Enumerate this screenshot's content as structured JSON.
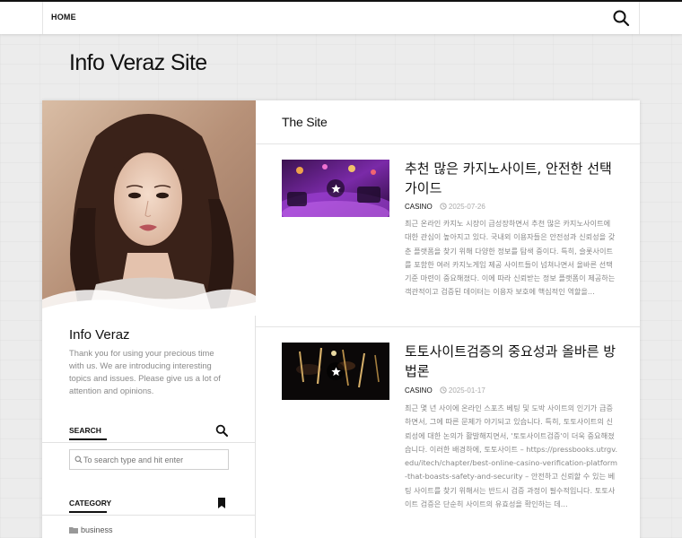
{
  "nav": {
    "home_label": "HOME"
  },
  "site": {
    "title": "Info Veraz Site"
  },
  "sidebar": {
    "profile_name": "Info Veraz",
    "profile_bio": "Thank you for using your precious time with us. We are introducing interesting topics and issues. Please give us a lot of attention and opinions.",
    "search_heading": "SEARCH",
    "search_placeholder": "To search type and hit enter",
    "category_heading": "CATEGORY",
    "categories": [
      {
        "label": "business"
      }
    ]
  },
  "main": {
    "section_title": "The Site",
    "posts": [
      {
        "title": "추천 많은 카지노사이트, 안전한 선택 가이드",
        "category": "CASINO",
        "date": "2025-07-26",
        "excerpt": "최근 온라인 카지노 시장이 급성장하면서 추천 많은 카지노사이트에 대한 관심이 높아지고 있다. 국내외 이용자들은 안전성과 신뢰성을 갖춘 플랫폼을 찾기 위해 다양한 정보를 탐색 중이다. 특히, 슬롯사이트를 포함한 여러 카지노게임 제공 사이트들이 넘쳐나면서 올바른 선택 기준 마련이 중요해졌다. 이에 따라 신뢰받는 정보 플랫폼이 제공하는 객관적이고 검증된 데이터는 이용자 보호에 핵심적인 역할을..."
      },
      {
        "title": "토토사이트검증의 중요성과 올바른 방법론",
        "category": "CASINO",
        "date": "2025-01-17",
        "excerpt": "최근 몇 년 사이에 온라인 스포츠 베팅 및 도박 사이트의 인기가 급증하면서, 그에 따른 문제가 야기되고 있습니다. 특히, 토토사이트의 신뢰성에 대한 논의가 활발해지면서, '토토사이트검증'이 더욱 중요해졌습니다. 이러한 배경하에, 토토사이트 – https://pressbooks.utrgv.edu/itech/chapter/best-online-casino-verification-platform-that-boasts-safety-and-security – 안전하고 신뢰할 수 있는 베팅 사이트를 찾기 위해서는 반드시 검증 과정이 필수적입니다. 토토사이트 검증은 단순히 사이트의 유효성을 확인하는 데..."
      }
    ]
  },
  "colors": {
    "text": "#111111",
    "muted": "#888888",
    "accent_purple": "#6a2a9e"
  },
  "icons": [
    "search-icon",
    "bookmark-icon",
    "folder-icon",
    "clock-icon",
    "star-icon"
  ]
}
